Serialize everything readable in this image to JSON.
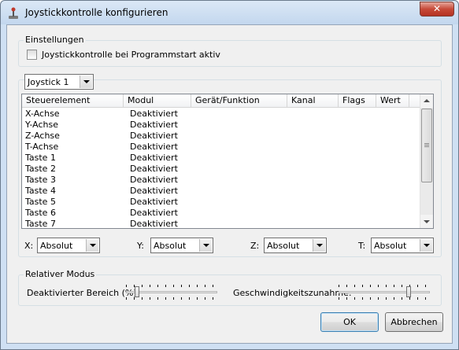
{
  "window": {
    "title": "Joystickkontrolle konfigurieren",
    "close_label": "✕"
  },
  "settings": {
    "group_label": "Einstellungen",
    "checkbox_label": "Joystickkontrolle bei Programmstart aktiv",
    "checked": false
  },
  "joystick": {
    "selected": "Joystick 1"
  },
  "table": {
    "columns": [
      "Steuerelement",
      "Modul",
      "Gerät/Funktion",
      "Kanal",
      "Flags",
      "Wert"
    ],
    "rows": [
      [
        "X-Achse",
        "Deaktiviert"
      ],
      [
        "Y-Achse",
        "Deaktiviert"
      ],
      [
        "Z-Achse",
        "Deaktiviert"
      ],
      [
        "T-Achse",
        "Deaktiviert"
      ],
      [
        "Taste 1",
        "Deaktiviert"
      ],
      [
        "Taste 2",
        "Deaktiviert"
      ],
      [
        "Taste 3",
        "Deaktiviert"
      ],
      [
        "Taste 4",
        "Deaktiviert"
      ],
      [
        "Taste 5",
        "Deaktiviert"
      ],
      [
        "Taste 6",
        "Deaktiviert"
      ],
      [
        "Taste 7",
        "Deaktiviert"
      ]
    ]
  },
  "axes": [
    {
      "label": "X:",
      "value": "Absolut"
    },
    {
      "label": "Y:",
      "value": "Absolut"
    },
    {
      "label": "Z:",
      "value": "Absolut"
    },
    {
      "label": "T:",
      "value": "Absolut"
    }
  ],
  "relative": {
    "group_label": "Relativer Modus",
    "deadzone_label": "Deaktivierter Bereich (%):",
    "deadzone_level": 0.1,
    "accel_label": "Geschwindigkeitszunahme:",
    "accel_level": 0.8
  },
  "buttons": {
    "ok": "OK",
    "cancel": "Abbrechen"
  }
}
